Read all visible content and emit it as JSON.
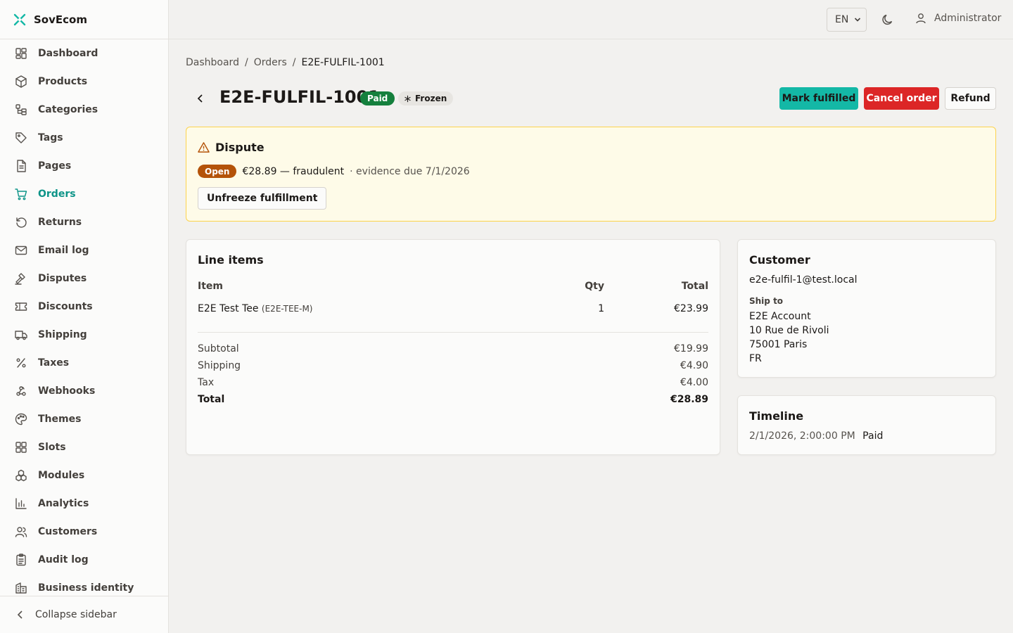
{
  "brand": {
    "name": "SovEcom",
    "accent": "#0d9488"
  },
  "sidebar": {
    "items": [
      {
        "label": "Dashboard",
        "icon": "dashboard-icon"
      },
      {
        "label": "Products",
        "icon": "package-icon"
      },
      {
        "label": "Categories",
        "icon": "categories-icon"
      },
      {
        "label": "Tags",
        "icon": "tag-icon"
      },
      {
        "label": "Pages",
        "icon": "page-icon"
      },
      {
        "label": "Orders",
        "icon": "cart-icon",
        "active": true
      },
      {
        "label": "Returns",
        "icon": "return-icon"
      },
      {
        "label": "Email log",
        "icon": "mail-icon"
      },
      {
        "label": "Disputes",
        "icon": "gavel-icon"
      },
      {
        "label": "Discounts",
        "icon": "ticket-icon"
      },
      {
        "label": "Shipping",
        "icon": "truck-icon"
      },
      {
        "label": "Taxes",
        "icon": "percent-icon"
      },
      {
        "label": "Webhooks",
        "icon": "webhook-icon"
      },
      {
        "label": "Themes",
        "icon": "palette-icon"
      },
      {
        "label": "Slots",
        "icon": "grid-icon"
      },
      {
        "label": "Modules",
        "icon": "modules-icon"
      },
      {
        "label": "Analytics",
        "icon": "chart-icon"
      },
      {
        "label": "Customers",
        "icon": "users-icon"
      },
      {
        "label": "Audit log",
        "icon": "clipboard-icon"
      },
      {
        "label": "Business identity",
        "icon": "building-icon"
      }
    ],
    "collapse_label": "Collapse sidebar"
  },
  "topbar": {
    "language": "EN",
    "user": "Administrator"
  },
  "breadcrumb": {
    "home": "Dashboard",
    "section": "Orders",
    "current": "E2E-FULFIL-1001",
    "sep": "/"
  },
  "order": {
    "id": "E2E-FULFIL-1001",
    "status": "Paid",
    "frozen_label": "Frozen",
    "actions": {
      "fulfill": "Mark fulfilled",
      "cancel": "Cancel order",
      "refund": "Refund"
    }
  },
  "dispute": {
    "title": "Dispute",
    "status": "Open",
    "amount_reason": "€28.89 — fraudulent",
    "due": "· evidence due 7/1/2026",
    "unfreeze_label": "Unfreeze fulfillment"
  },
  "line_items": {
    "title": "Line items",
    "headers": {
      "item": "Item",
      "qty": "Qty",
      "total": "Total"
    },
    "rows": [
      {
        "name": "E2E Test Tee",
        "sku": "(E2E-TEE-M)",
        "qty": "1",
        "total": "€23.99"
      }
    ],
    "summary": {
      "subtotal_label": "Subtotal",
      "subtotal": "€19.99",
      "shipping_label": "Shipping",
      "shipping": "€4.90",
      "tax_label": "Tax",
      "tax": "€4.00",
      "total_label": "Total",
      "total": "€28.89"
    }
  },
  "customer": {
    "title": "Customer",
    "email": "e2e-fulfil-1@test.local",
    "ship_to_label": "Ship to",
    "address": [
      "E2E Account",
      "10 Rue de Rivoli",
      "75001 Paris",
      "FR"
    ]
  },
  "timeline": {
    "title": "Timeline",
    "events": [
      {
        "time": "2/1/2026, 2:00:00 PM",
        "label": "Paid"
      }
    ]
  }
}
